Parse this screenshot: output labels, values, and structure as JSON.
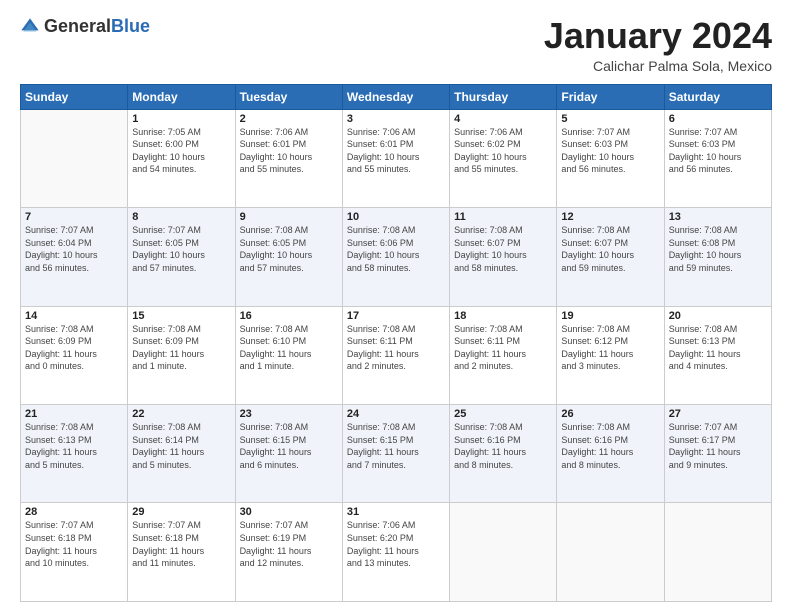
{
  "header": {
    "logo_general": "General",
    "logo_blue": "Blue",
    "month_title": "January 2024",
    "location": "Calichar Palma Sola, Mexico"
  },
  "weekdays": [
    "Sunday",
    "Monday",
    "Tuesday",
    "Wednesday",
    "Thursday",
    "Friday",
    "Saturday"
  ],
  "weeks": [
    [
      {
        "day": "",
        "info": ""
      },
      {
        "day": "1",
        "info": "Sunrise: 7:05 AM\nSunset: 6:00 PM\nDaylight: 10 hours\nand 54 minutes."
      },
      {
        "day": "2",
        "info": "Sunrise: 7:06 AM\nSunset: 6:01 PM\nDaylight: 10 hours\nand 55 minutes."
      },
      {
        "day": "3",
        "info": "Sunrise: 7:06 AM\nSunset: 6:01 PM\nDaylight: 10 hours\nand 55 minutes."
      },
      {
        "day": "4",
        "info": "Sunrise: 7:06 AM\nSunset: 6:02 PM\nDaylight: 10 hours\nand 55 minutes."
      },
      {
        "day": "5",
        "info": "Sunrise: 7:07 AM\nSunset: 6:03 PM\nDaylight: 10 hours\nand 56 minutes."
      },
      {
        "day": "6",
        "info": "Sunrise: 7:07 AM\nSunset: 6:03 PM\nDaylight: 10 hours\nand 56 minutes."
      }
    ],
    [
      {
        "day": "7",
        "info": "Sunrise: 7:07 AM\nSunset: 6:04 PM\nDaylight: 10 hours\nand 56 minutes."
      },
      {
        "day": "8",
        "info": "Sunrise: 7:07 AM\nSunset: 6:05 PM\nDaylight: 10 hours\nand 57 minutes."
      },
      {
        "day": "9",
        "info": "Sunrise: 7:08 AM\nSunset: 6:05 PM\nDaylight: 10 hours\nand 57 minutes."
      },
      {
        "day": "10",
        "info": "Sunrise: 7:08 AM\nSunset: 6:06 PM\nDaylight: 10 hours\nand 58 minutes."
      },
      {
        "day": "11",
        "info": "Sunrise: 7:08 AM\nSunset: 6:07 PM\nDaylight: 10 hours\nand 58 minutes."
      },
      {
        "day": "12",
        "info": "Sunrise: 7:08 AM\nSunset: 6:07 PM\nDaylight: 10 hours\nand 59 minutes."
      },
      {
        "day": "13",
        "info": "Sunrise: 7:08 AM\nSunset: 6:08 PM\nDaylight: 10 hours\nand 59 minutes."
      }
    ],
    [
      {
        "day": "14",
        "info": "Sunrise: 7:08 AM\nSunset: 6:09 PM\nDaylight: 11 hours\nand 0 minutes."
      },
      {
        "day": "15",
        "info": "Sunrise: 7:08 AM\nSunset: 6:09 PM\nDaylight: 11 hours\nand 1 minute."
      },
      {
        "day": "16",
        "info": "Sunrise: 7:08 AM\nSunset: 6:10 PM\nDaylight: 11 hours\nand 1 minute."
      },
      {
        "day": "17",
        "info": "Sunrise: 7:08 AM\nSunset: 6:11 PM\nDaylight: 11 hours\nand 2 minutes."
      },
      {
        "day": "18",
        "info": "Sunrise: 7:08 AM\nSunset: 6:11 PM\nDaylight: 11 hours\nand 2 minutes."
      },
      {
        "day": "19",
        "info": "Sunrise: 7:08 AM\nSunset: 6:12 PM\nDaylight: 11 hours\nand 3 minutes."
      },
      {
        "day": "20",
        "info": "Sunrise: 7:08 AM\nSunset: 6:13 PM\nDaylight: 11 hours\nand 4 minutes."
      }
    ],
    [
      {
        "day": "21",
        "info": "Sunrise: 7:08 AM\nSunset: 6:13 PM\nDaylight: 11 hours\nand 5 minutes."
      },
      {
        "day": "22",
        "info": "Sunrise: 7:08 AM\nSunset: 6:14 PM\nDaylight: 11 hours\nand 5 minutes."
      },
      {
        "day": "23",
        "info": "Sunrise: 7:08 AM\nSunset: 6:15 PM\nDaylight: 11 hours\nand 6 minutes."
      },
      {
        "day": "24",
        "info": "Sunrise: 7:08 AM\nSunset: 6:15 PM\nDaylight: 11 hours\nand 7 minutes."
      },
      {
        "day": "25",
        "info": "Sunrise: 7:08 AM\nSunset: 6:16 PM\nDaylight: 11 hours\nand 8 minutes."
      },
      {
        "day": "26",
        "info": "Sunrise: 7:08 AM\nSunset: 6:16 PM\nDaylight: 11 hours\nand 8 minutes."
      },
      {
        "day": "27",
        "info": "Sunrise: 7:07 AM\nSunset: 6:17 PM\nDaylight: 11 hours\nand 9 minutes."
      }
    ],
    [
      {
        "day": "28",
        "info": "Sunrise: 7:07 AM\nSunset: 6:18 PM\nDaylight: 11 hours\nand 10 minutes."
      },
      {
        "day": "29",
        "info": "Sunrise: 7:07 AM\nSunset: 6:18 PM\nDaylight: 11 hours\nand 11 minutes."
      },
      {
        "day": "30",
        "info": "Sunrise: 7:07 AM\nSunset: 6:19 PM\nDaylight: 11 hours\nand 12 minutes."
      },
      {
        "day": "31",
        "info": "Sunrise: 7:06 AM\nSunset: 6:20 PM\nDaylight: 11 hours\nand 13 minutes."
      },
      {
        "day": "",
        "info": ""
      },
      {
        "day": "",
        "info": ""
      },
      {
        "day": "",
        "info": ""
      }
    ]
  ]
}
